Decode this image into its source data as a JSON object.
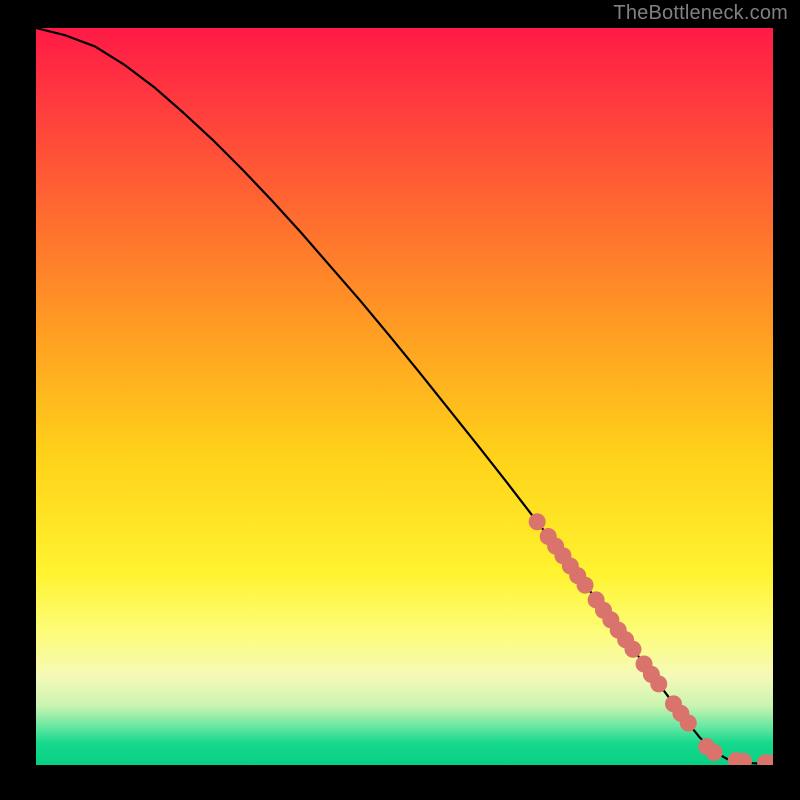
{
  "attribution": "TheBottleneck.com",
  "chart_data": {
    "type": "line",
    "title": "",
    "xlabel": "",
    "ylabel": "",
    "xlim": [
      0,
      100
    ],
    "ylim": [
      0,
      100
    ],
    "grid": false,
    "legend": false,
    "series": [
      {
        "name": "curve",
        "style": "line",
        "color": "#000000",
        "x": [
          0,
          4,
          8,
          12,
          16,
          20,
          24,
          28,
          32,
          36,
          40,
          44,
          48,
          52,
          56,
          60,
          64,
          68,
          72,
          76,
          80,
          84,
          86,
          88,
          90,
          92,
          94,
          96,
          98,
          100
        ],
        "y": [
          100,
          99,
          97.5,
          95,
          92,
          88.5,
          84.8,
          80.8,
          76.6,
          72.2,
          67.6,
          63,
          58.2,
          53.3,
          48.3,
          43.3,
          38.2,
          33,
          27.8,
          22.5,
          17.1,
          11.7,
          9,
          6.3,
          3.8,
          1.8,
          0.7,
          0.3,
          0.2,
          0.2
        ]
      },
      {
        "name": "markers",
        "style": "scatter",
        "color": "#d9736b",
        "x": [
          68,
          69.5,
          70.5,
          71.5,
          72.5,
          73.5,
          74.5,
          76,
          77,
          78,
          79,
          80,
          81,
          82.5,
          83.5,
          84.5,
          86.5,
          87.5,
          88.5,
          91,
          92,
          95,
          96,
          99,
          100
        ],
        "y": [
          33,
          31,
          29.7,
          28.4,
          27,
          25.7,
          24.4,
          22.4,
          21,
          19.7,
          18.3,
          17,
          15.7,
          13.7,
          12.3,
          11,
          8.3,
          7,
          5.7,
          2.5,
          1.7,
          0.6,
          0.5,
          0.3,
          0.3
        ]
      }
    ]
  }
}
